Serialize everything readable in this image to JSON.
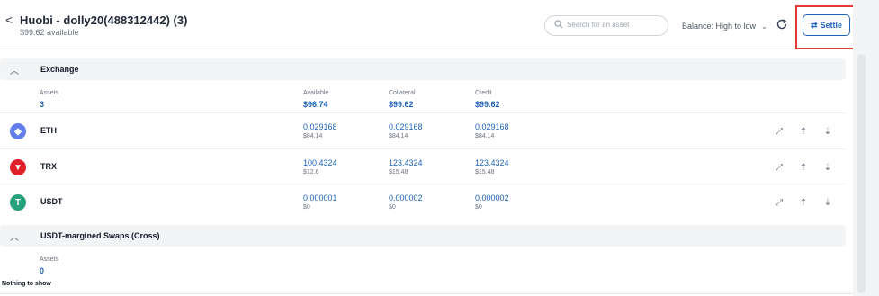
{
  "header": {
    "back_glyph": "<",
    "title": "Huobi - dolly20(488312442) (3)",
    "available": "$99.62 available",
    "search_placeholder": "Search for an asset",
    "balance_sort": "Balance: High to low",
    "settle_label": "Settle"
  },
  "exchange": {
    "title": "Exchange",
    "summary": {
      "assets_label": "Assets",
      "assets_value": "3",
      "available_label": "Available",
      "available_value": "$96.74",
      "collateral_label": "Collateral",
      "collateral_value": "$99.62",
      "credit_label": "Credit",
      "credit_value": "$99.62"
    },
    "rows": [
      {
        "coin": "ETH",
        "icon": "eth-icon",
        "color": "#627eea",
        "glyph": "◆",
        "available": "0.029168",
        "available_usd": "$84.14",
        "collateral": "0.029168",
        "collateral_usd": "$84.14",
        "credit": "0.029168",
        "credit_usd": "$84.14"
      },
      {
        "coin": "TRX",
        "icon": "trx-icon",
        "color": "#e0212c",
        "glyph": "▼",
        "available": "100.4324",
        "available_usd": "$12.6",
        "collateral": "123.4324",
        "collateral_usd": "$15.48",
        "credit": "123.4324",
        "credit_usd": "$15.48"
      },
      {
        "coin": "USDT",
        "icon": "usdt-icon",
        "color": "#26a17b",
        "glyph": "T",
        "available": "0.000001",
        "available_usd": "$0",
        "collateral": "0.000002",
        "collateral_usd": "$0",
        "credit": "0.000002",
        "credit_usd": "$0"
      }
    ]
  },
  "swaps": {
    "title": "USDT-margined Swaps (Cross)",
    "assets_label": "Assets",
    "assets_value": "0",
    "empty_text": "Nothing to show"
  },
  "colors": {
    "accent": "#1e63b8",
    "highlight": "#e53935"
  }
}
